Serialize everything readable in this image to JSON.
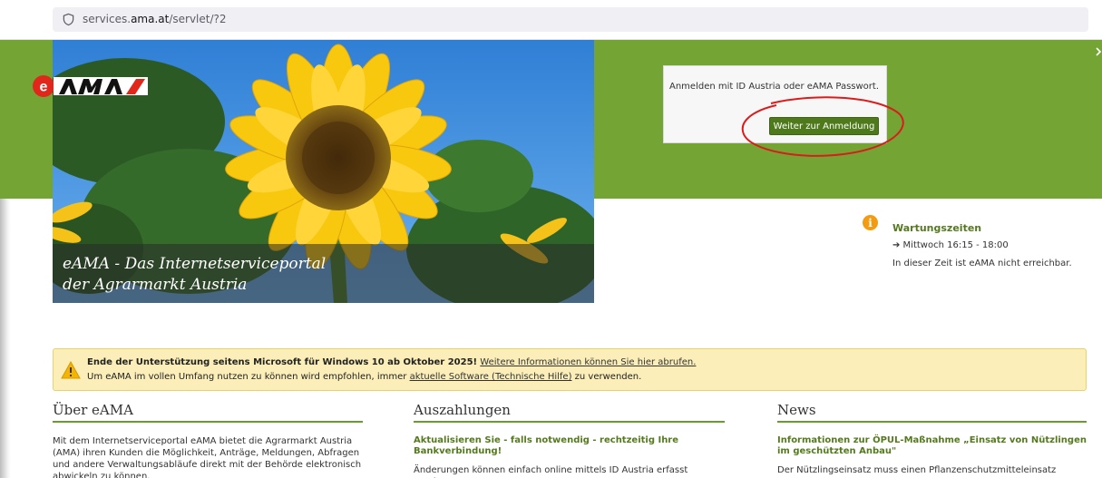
{
  "browser": {
    "url_prefix": "services.",
    "url_domain": "ama.at",
    "url_path": "/servlet/?2",
    "icons": [
      "shield-icon",
      "reader-view-icon",
      "save-to-pocket-icon",
      "bookmark-star-icon"
    ]
  },
  "hero": {
    "caption_line1": "eAMA - Das Internetserviceportal",
    "caption_line2": "der Agrarmarkt Austria"
  },
  "login": {
    "text": "Anmelden mit ID Austria oder eAMA Passwort.",
    "button_label": "Weiter zur Anmeldung"
  },
  "maintenance": {
    "icon": "info-icon",
    "title": "Wartungszeiten",
    "time": "➔ Mittwoch 16:15 - 18:00",
    "note": "In dieser Zeit ist eAMA nicht erreichbar."
  },
  "notice": {
    "bold_text": "Ende der Unterstützung seitens Microsoft für Windows 10 ab Oktober 2025!",
    "link1": "Weitere Informationen können Sie hier abrufen.",
    "line2_before": "Um eAMA im vollen Umfang nutzen zu können wird empfohlen, immer ",
    "link2": "aktuelle Software (Technische Hilfe)",
    "line2_after": " zu verwenden."
  },
  "columns": {
    "about": {
      "title": "Über eAMA",
      "body": "Mit dem Internetserviceportal eAMA bietet die Agrarmarkt Austria (AMA) ihren Kunden die Möglichkeit, Anträge, Meldungen, Abfragen und andere Verwaltungsabläufe direkt mit der Behörde elektronisch abwickeln zu können."
    },
    "payments": {
      "title": "Auszahlungen",
      "headline": "Aktualisieren Sie - falls notwendig - rechtzeitig Ihre Bankverbindung!",
      "body": "Änderungen können einfach online mittels ID Austria erfasst werden."
    },
    "news": {
      "title": "News",
      "headline": "Informationen zur ÖPUL-Maßnahme „Einsatz von Nützlingen im geschützten Anbau\"",
      "body": "Der Nützlingseinsatz muss einen Pflanzenschutzmitteleinsatz ersetzen."
    }
  },
  "colors": {
    "brand_green": "#74a534",
    "button_green": "#4f7a1c",
    "logo_red": "#e1261c",
    "accent_orange": "#f39c12"
  }
}
